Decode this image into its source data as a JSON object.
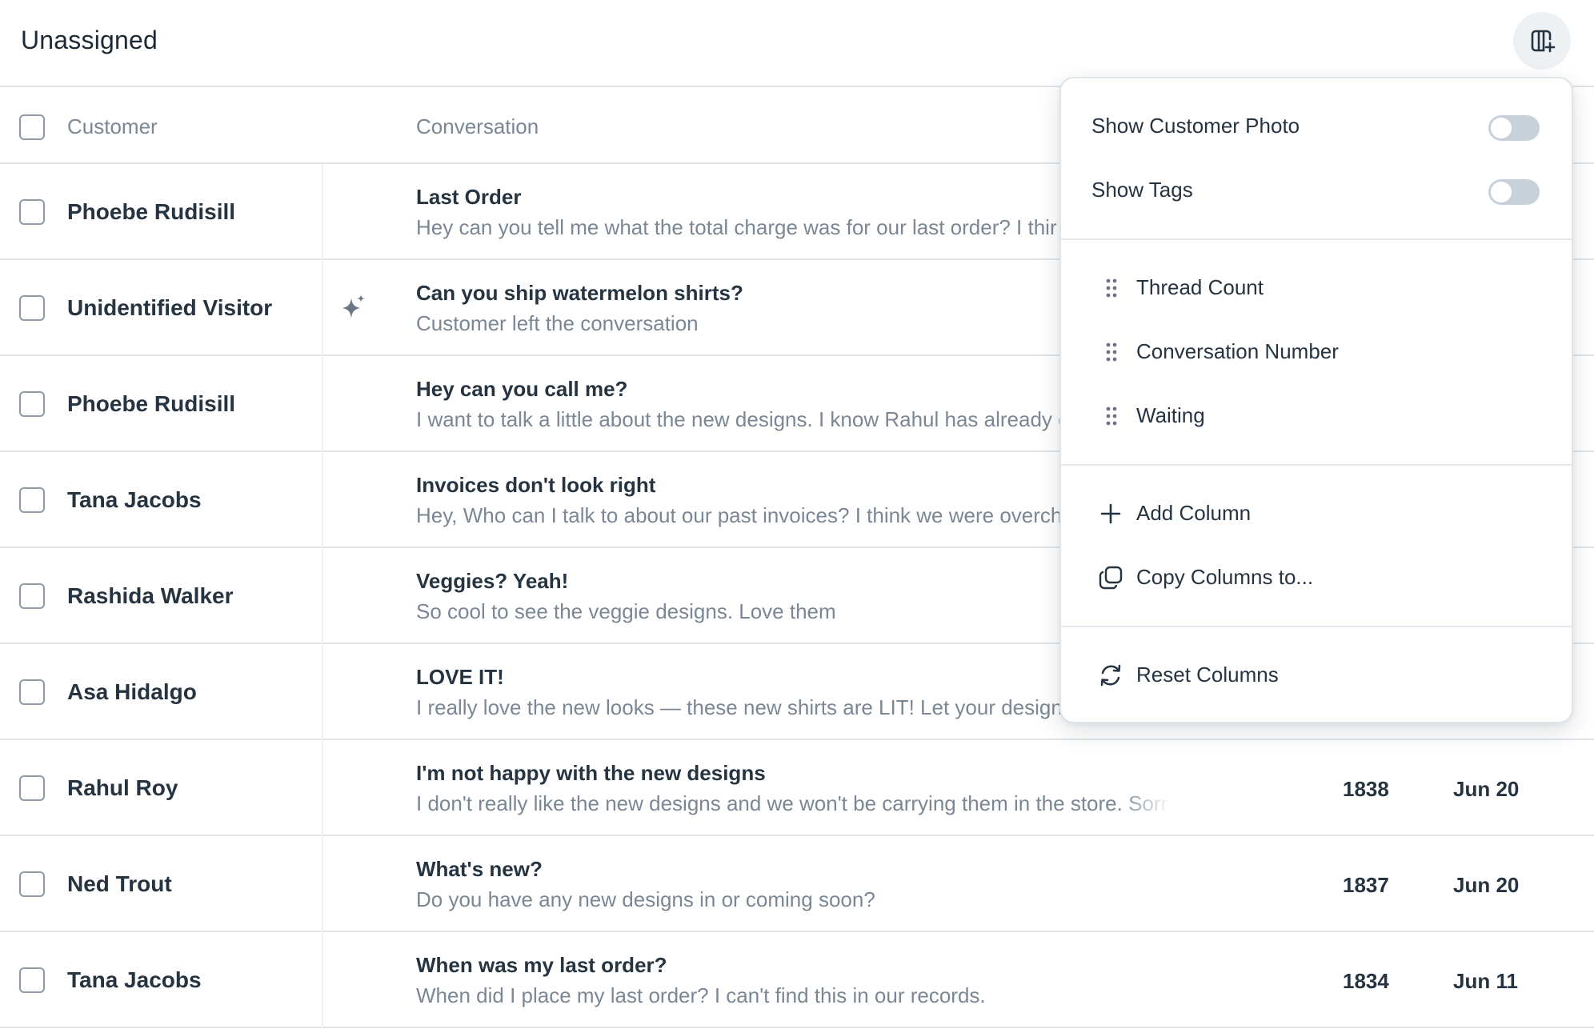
{
  "header": {
    "title": "Unassigned"
  },
  "table": {
    "columns": {
      "customer": "Customer",
      "conversation": "Conversation"
    },
    "rows": [
      {
        "customer": "Phoebe Rudisill",
        "subject": "Last Order",
        "preview": "Hey can you tell me what the total charge was for our last order? I thir",
        "number": "",
        "date": ""
      },
      {
        "customer": "Unidentified Visitor",
        "subject": "Can you ship watermelon shirts?",
        "preview": "Customer left the conversation",
        "number": "",
        "date": ""
      },
      {
        "customer": "Phoebe Rudisill",
        "subject": "Hey can you call me?",
        "preview": "I want to talk a little about the new designs. I know Rahul has already c",
        "number": "",
        "date": ""
      },
      {
        "customer": "Tana Jacobs",
        "subject": "Invoices don't look right",
        "preview": "Hey, Who can I talk to about our past invoices? I think we were overch",
        "number": "",
        "date": ""
      },
      {
        "customer": "Rashida Walker",
        "subject": "Veggies? Yeah!",
        "preview": "So cool to see the veggie designs. Love them",
        "number": "",
        "date": ""
      },
      {
        "customer": "Asa Hidalgo",
        "subject": "LOVE IT!",
        "preview": "I really love the new looks — these new shirts are LIT! Let your design",
        "number": "",
        "date": ""
      },
      {
        "customer": "Rahul Roy",
        "subject": "I'm not happy with the new designs",
        "preview": "I don't really like the new designs and we won't be carrying them in the store. Sorr",
        "number": "1838",
        "date": "Jun 20"
      },
      {
        "customer": "Ned Trout",
        "subject": "What's new?",
        "preview": "Do you have any new designs in or coming soon?",
        "number": "1837",
        "date": "Jun 20"
      },
      {
        "customer": "Tana Jacobs",
        "subject": "When was my last order?",
        "preview": "When did I place my last order? I can't find this in our records.",
        "number": "1834",
        "date": "Jun 11"
      }
    ]
  },
  "columns_menu": {
    "toggles": [
      {
        "label": "Show Customer Photo",
        "on": false
      },
      {
        "label": "Show Tags",
        "on": false
      }
    ],
    "visible_columns": [
      "Thread Count",
      "Conversation Number",
      "Waiting"
    ],
    "add_column": "Add Column",
    "copy_columns": "Copy Columns to...",
    "reset_columns": "Reset Columns"
  },
  "icons": {
    "columns_button": "columns-add-icon",
    "ai": "sparkle-icon",
    "drag": "drag-handle-icon",
    "add": "plus-icon",
    "copy": "copy-icon",
    "reset": "reset-icon"
  },
  "colors": {
    "text_primary": "#263442",
    "text_muted": "#7b8794",
    "border": "#dfe4e9",
    "toggle_off": "#c8d0d8"
  }
}
